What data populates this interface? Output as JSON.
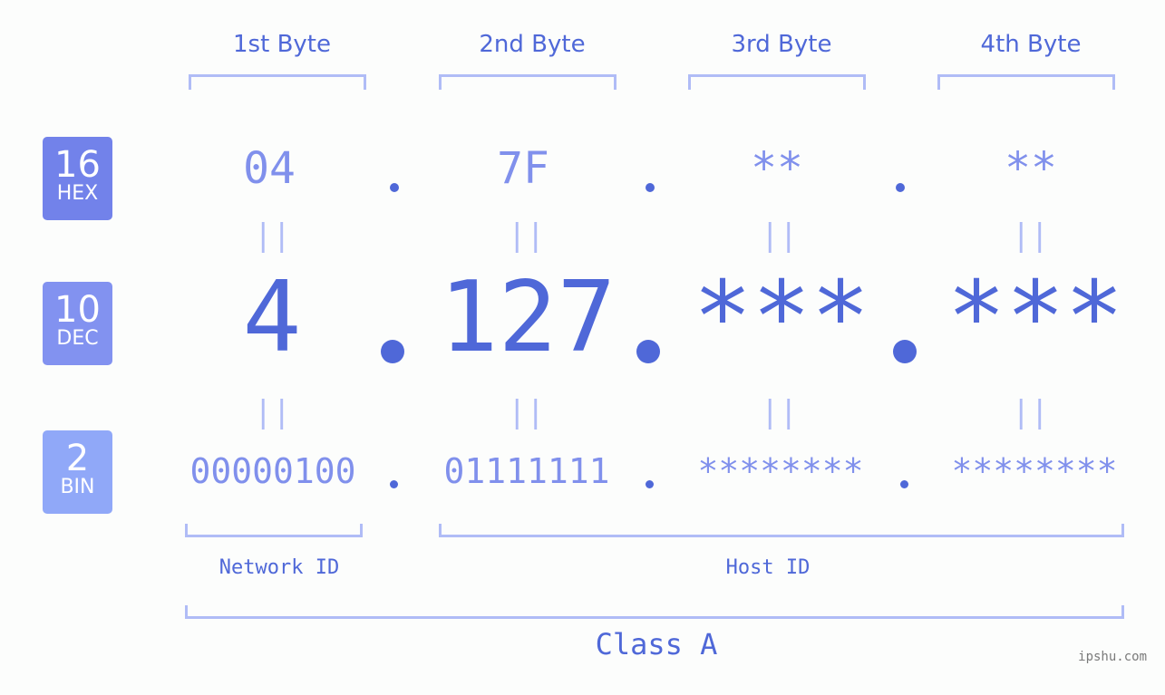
{
  "bytes": [
    {
      "label": "1st Byte",
      "hex": "04",
      "dec": "4",
      "bin": "00000100"
    },
    {
      "label": "2nd Byte",
      "hex": "7F",
      "dec": "127",
      "bin": "01111111"
    },
    {
      "label": "3rd Byte",
      "hex": "**",
      "dec": "***",
      "bin": "********"
    },
    {
      "label": "4th Byte",
      "hex": "**",
      "dec": "***",
      "bin": "********"
    }
  ],
  "badges": {
    "hex": {
      "num": "16",
      "label": "HEX",
      "color": "#7282ea"
    },
    "dec": {
      "num": "10",
      "label": "DEC",
      "color": "#8292f0"
    },
    "bin": {
      "num": "2",
      "label": "BIN",
      "color": "#90a8f8"
    }
  },
  "equals": "||",
  "network_id": "Network ID",
  "host_id": "Host ID",
  "class_label": "Class A",
  "watermark": "ipshu.com"
}
